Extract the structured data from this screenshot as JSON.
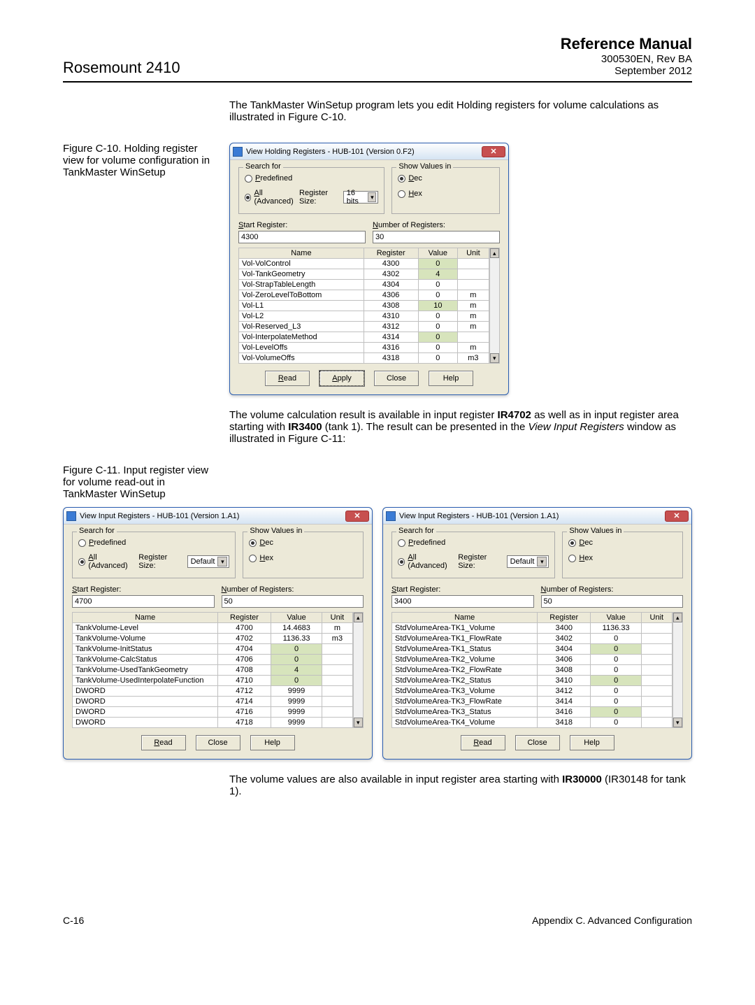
{
  "header": {
    "left_title": "Rosemount 2410",
    "ref_title": "Reference Manual",
    "doc_num": "300530EN, Rev BA",
    "date": "September 2012"
  },
  "paragraph_1": "The TankMaster WinSetup program lets you edit Holding registers for volume calculations as illustrated in Figure C-10.",
  "figure_c10_caption": "Figure C-10. Holding register view for volume configuration in TankMaster WinSetup",
  "dialog1": {
    "title": "View Holding Registers - HUB-101 (Version 0.F2)",
    "search_for_legend": "Search for",
    "show_values_legend": "Show Values in",
    "predefined_label": "Predefined",
    "all_advanced_label": "All (Advanced)",
    "register_size_label": "Register Size:",
    "register_size_value": "16 bits",
    "dec_label": "Dec",
    "hex_label": "Hex",
    "start_register_label": "Start Register:",
    "start_register_value": "4300",
    "num_registers_label": "Number of Registers:",
    "num_registers_value": "30",
    "col_name": "Name",
    "col_register": "Register",
    "col_value": "Value",
    "col_unit": "Unit",
    "rows": [
      {
        "name": "Vol-VolControl",
        "reg": "4300",
        "val": "0",
        "unit": "",
        "hl": true
      },
      {
        "name": "Vol-TankGeometry",
        "reg": "4302",
        "val": "4",
        "unit": "",
        "hl": true
      },
      {
        "name": "Vol-StrapTableLength",
        "reg": "4304",
        "val": "0",
        "unit": ""
      },
      {
        "name": "Vol-ZeroLevelToBottom",
        "reg": "4306",
        "val": "0",
        "unit": "m"
      },
      {
        "name": "Vol-L1",
        "reg": "4308",
        "val": "10",
        "unit": "m",
        "hl": true
      },
      {
        "name": "Vol-L2",
        "reg": "4310",
        "val": "0",
        "unit": "m"
      },
      {
        "name": "Vol-Reserved_L3",
        "reg": "4312",
        "val": "0",
        "unit": "m"
      },
      {
        "name": "Vol-InterpolateMethod",
        "reg": "4314",
        "val": "0",
        "unit": "",
        "hl": true
      },
      {
        "name": "Vol-LevelOffs",
        "reg": "4316",
        "val": "0",
        "unit": "m"
      },
      {
        "name": "Vol-VolumeOffs",
        "reg": "4318",
        "val": "0",
        "unit": "m3"
      }
    ],
    "btn_read": "Read",
    "btn_apply": "Apply",
    "btn_close": "Close",
    "btn_help": "Help"
  },
  "paragraph_2a": "The volume calculation result is available in input register ",
  "paragraph_2_bold1": "IR4702",
  "paragraph_2b": " as well as in input register area starting with ",
  "paragraph_2_bold2": "IR3400",
  "paragraph_2c": " (tank 1). The result can be presented in the ",
  "paragraph_2_italic": "View Input Registers",
  "paragraph_2d": " window as illustrated in Figure C-11:",
  "figure_c11_caption": "Figure C-11. Input register view for volume read-out in TankMaster WinSetup",
  "dialog2": {
    "title": "View Input Registers - HUB-101 (Version 1.A1)",
    "register_size_value": "Default",
    "start_register_value": "4700",
    "num_registers_value": "50",
    "rows": [
      {
        "name": "TankVolume-Level",
        "reg": "4700",
        "val": "14.4683",
        "unit": "m"
      },
      {
        "name": "TankVolume-Volume",
        "reg": "4702",
        "val": "1136.33",
        "unit": "m3"
      },
      {
        "name": "TankVolume-InitStatus",
        "reg": "4704",
        "val": "0",
        "unit": "",
        "hl": true
      },
      {
        "name": "TankVolume-CalcStatus",
        "reg": "4706",
        "val": "0",
        "unit": "",
        "hl": true
      },
      {
        "name": "TankVolume-UsedTankGeometry",
        "reg": "4708",
        "val": "4",
        "unit": "",
        "hl": true
      },
      {
        "name": "TankVolume-UsedInterpolateFunction",
        "reg": "4710",
        "val": "0",
        "unit": "",
        "hl": true
      },
      {
        "name": "DWORD",
        "reg": "4712",
        "val": "9999",
        "unit": ""
      },
      {
        "name": "DWORD",
        "reg": "4714",
        "val": "9999",
        "unit": ""
      },
      {
        "name": "DWORD",
        "reg": "4716",
        "val": "9999",
        "unit": ""
      },
      {
        "name": "DWORD",
        "reg": "4718",
        "val": "9999",
        "unit": ""
      }
    ]
  },
  "dialog3": {
    "title": "View Input Registers - HUB-101 (Version 1.A1)",
    "register_size_value": "Default",
    "start_register_value": "3400",
    "num_registers_value": "50",
    "rows": [
      {
        "name": "StdVolumeArea-TK1_Volume",
        "reg": "3400",
        "val": "1136.33",
        "unit": ""
      },
      {
        "name": "StdVolumeArea-TK1_FlowRate",
        "reg": "3402",
        "val": "0",
        "unit": ""
      },
      {
        "name": "StdVolumeArea-TK1_Status",
        "reg": "3404",
        "val": "0",
        "unit": "",
        "hl": true
      },
      {
        "name": "StdVolumeArea-TK2_Volume",
        "reg": "3406",
        "val": "0",
        "unit": ""
      },
      {
        "name": "StdVolumeArea-TK2_FlowRate",
        "reg": "3408",
        "val": "0",
        "unit": ""
      },
      {
        "name": "StdVolumeArea-TK2_Status",
        "reg": "3410",
        "val": "0",
        "unit": "",
        "hl": true
      },
      {
        "name": "StdVolumeArea-TK3_Volume",
        "reg": "3412",
        "val": "0",
        "unit": ""
      },
      {
        "name": "StdVolumeArea-TK3_FlowRate",
        "reg": "3414",
        "val": "0",
        "unit": ""
      },
      {
        "name": "StdVolumeArea-TK3_Status",
        "reg": "3416",
        "val": "0",
        "unit": "",
        "hl": true
      },
      {
        "name": "StdVolumeArea-TK4_Volume",
        "reg": "3418",
        "val": "0",
        "unit": ""
      }
    ]
  },
  "paragraph_3a": "The volume values are also available in input register area starting with ",
  "paragraph_3_bold": "IR30000",
  "paragraph_3b": " (IR30148 for tank 1).",
  "footer": {
    "left": "C-16",
    "right": "Appendix C. Advanced Configuration"
  }
}
